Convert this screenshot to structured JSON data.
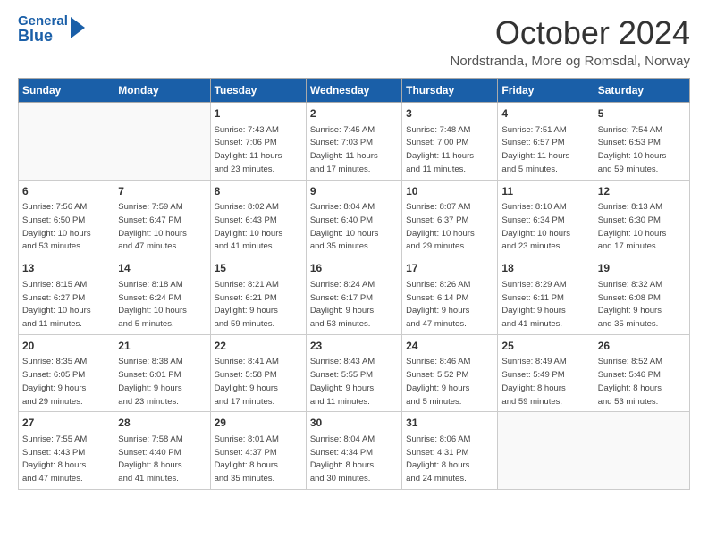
{
  "header": {
    "logo_general": "General",
    "logo_blue": "Blue",
    "month_title": "October 2024",
    "location": "Nordstranda, More og Romsdal, Norway"
  },
  "days_of_week": [
    "Sunday",
    "Monday",
    "Tuesday",
    "Wednesday",
    "Thursday",
    "Friday",
    "Saturday"
  ],
  "weeks": [
    [
      {
        "day": "",
        "detail": ""
      },
      {
        "day": "",
        "detail": ""
      },
      {
        "day": "1",
        "detail": "Sunrise: 7:43 AM\nSunset: 7:06 PM\nDaylight: 11 hours\nand 23 minutes."
      },
      {
        "day": "2",
        "detail": "Sunrise: 7:45 AM\nSunset: 7:03 PM\nDaylight: 11 hours\nand 17 minutes."
      },
      {
        "day": "3",
        "detail": "Sunrise: 7:48 AM\nSunset: 7:00 PM\nDaylight: 11 hours\nand 11 minutes."
      },
      {
        "day": "4",
        "detail": "Sunrise: 7:51 AM\nSunset: 6:57 PM\nDaylight: 11 hours\nand 5 minutes."
      },
      {
        "day": "5",
        "detail": "Sunrise: 7:54 AM\nSunset: 6:53 PM\nDaylight: 10 hours\nand 59 minutes."
      }
    ],
    [
      {
        "day": "6",
        "detail": "Sunrise: 7:56 AM\nSunset: 6:50 PM\nDaylight: 10 hours\nand 53 minutes."
      },
      {
        "day": "7",
        "detail": "Sunrise: 7:59 AM\nSunset: 6:47 PM\nDaylight: 10 hours\nand 47 minutes."
      },
      {
        "day": "8",
        "detail": "Sunrise: 8:02 AM\nSunset: 6:43 PM\nDaylight: 10 hours\nand 41 minutes."
      },
      {
        "day": "9",
        "detail": "Sunrise: 8:04 AM\nSunset: 6:40 PM\nDaylight: 10 hours\nand 35 minutes."
      },
      {
        "day": "10",
        "detail": "Sunrise: 8:07 AM\nSunset: 6:37 PM\nDaylight: 10 hours\nand 29 minutes."
      },
      {
        "day": "11",
        "detail": "Sunrise: 8:10 AM\nSunset: 6:34 PM\nDaylight: 10 hours\nand 23 minutes."
      },
      {
        "day": "12",
        "detail": "Sunrise: 8:13 AM\nSunset: 6:30 PM\nDaylight: 10 hours\nand 17 minutes."
      }
    ],
    [
      {
        "day": "13",
        "detail": "Sunrise: 8:15 AM\nSunset: 6:27 PM\nDaylight: 10 hours\nand 11 minutes."
      },
      {
        "day": "14",
        "detail": "Sunrise: 8:18 AM\nSunset: 6:24 PM\nDaylight: 10 hours\nand 5 minutes."
      },
      {
        "day": "15",
        "detail": "Sunrise: 8:21 AM\nSunset: 6:21 PM\nDaylight: 9 hours\nand 59 minutes."
      },
      {
        "day": "16",
        "detail": "Sunrise: 8:24 AM\nSunset: 6:17 PM\nDaylight: 9 hours\nand 53 minutes."
      },
      {
        "day": "17",
        "detail": "Sunrise: 8:26 AM\nSunset: 6:14 PM\nDaylight: 9 hours\nand 47 minutes."
      },
      {
        "day": "18",
        "detail": "Sunrise: 8:29 AM\nSunset: 6:11 PM\nDaylight: 9 hours\nand 41 minutes."
      },
      {
        "day": "19",
        "detail": "Sunrise: 8:32 AM\nSunset: 6:08 PM\nDaylight: 9 hours\nand 35 minutes."
      }
    ],
    [
      {
        "day": "20",
        "detail": "Sunrise: 8:35 AM\nSunset: 6:05 PM\nDaylight: 9 hours\nand 29 minutes."
      },
      {
        "day": "21",
        "detail": "Sunrise: 8:38 AM\nSunset: 6:01 PM\nDaylight: 9 hours\nand 23 minutes."
      },
      {
        "day": "22",
        "detail": "Sunrise: 8:41 AM\nSunset: 5:58 PM\nDaylight: 9 hours\nand 17 minutes."
      },
      {
        "day": "23",
        "detail": "Sunrise: 8:43 AM\nSunset: 5:55 PM\nDaylight: 9 hours\nand 11 minutes."
      },
      {
        "day": "24",
        "detail": "Sunrise: 8:46 AM\nSunset: 5:52 PM\nDaylight: 9 hours\nand 5 minutes."
      },
      {
        "day": "25",
        "detail": "Sunrise: 8:49 AM\nSunset: 5:49 PM\nDaylight: 8 hours\nand 59 minutes."
      },
      {
        "day": "26",
        "detail": "Sunrise: 8:52 AM\nSunset: 5:46 PM\nDaylight: 8 hours\nand 53 minutes."
      }
    ],
    [
      {
        "day": "27",
        "detail": "Sunrise: 7:55 AM\nSunset: 4:43 PM\nDaylight: 8 hours\nand 47 minutes."
      },
      {
        "day": "28",
        "detail": "Sunrise: 7:58 AM\nSunset: 4:40 PM\nDaylight: 8 hours\nand 41 minutes."
      },
      {
        "day": "29",
        "detail": "Sunrise: 8:01 AM\nSunset: 4:37 PM\nDaylight: 8 hours\nand 35 minutes."
      },
      {
        "day": "30",
        "detail": "Sunrise: 8:04 AM\nSunset: 4:34 PM\nDaylight: 8 hours\nand 30 minutes."
      },
      {
        "day": "31",
        "detail": "Sunrise: 8:06 AM\nSunset: 4:31 PM\nDaylight: 8 hours\nand 24 minutes."
      },
      {
        "day": "",
        "detail": ""
      },
      {
        "day": "",
        "detail": ""
      }
    ]
  ]
}
